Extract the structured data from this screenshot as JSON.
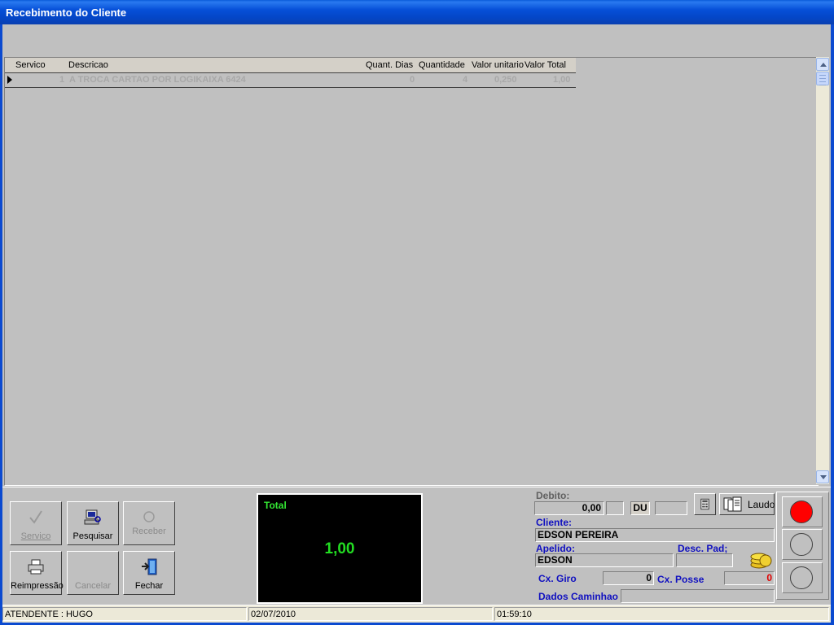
{
  "window": {
    "title": "Recebimento do Cliente"
  },
  "grid": {
    "columns": [
      "Servico",
      "Descricao",
      "Quant. Dias",
      "Quantidade",
      "Valor unitario",
      "Valor Total"
    ],
    "rows": [
      {
        "servico": "1",
        "descricao": "A TROCA CARTAO POR LOGIKAIXA 6424",
        "quant_dias": "0",
        "quantidade": "4",
        "valor_unitario": "0,250",
        "valor_total": "1,00"
      }
    ]
  },
  "toolbar": {
    "servico_label": "Servico",
    "pesquisar_label": "Pesquisar",
    "receber_label": "Receber",
    "reimpressao_label": "Reimpressão",
    "cancelar_label": "Cancelar",
    "fechar_label": "Fechar"
  },
  "total": {
    "label": "Total",
    "value": "1,00"
  },
  "right_panel": {
    "debito_label": "Debito:",
    "debito_value": "0,00",
    "du_label": "DU",
    "laudo_label": "Laudo",
    "cliente_label": "Cliente:",
    "cliente_value": "EDSON PEREIRA",
    "apelido_label": "Apelido:",
    "apelido_value": "EDSON",
    "desc_pad_label": "Desc. Pad;",
    "cx_giro_label": "Cx. Giro",
    "cx_giro_value": "0",
    "cx_posse_label": "Cx. Posse",
    "cx_posse_value": "0",
    "dados_caminhao_label": "Dados Caminhao"
  },
  "status_lights": {
    "colors": [
      "#ff0000",
      "#c0c0c0",
      "#c0c0c0"
    ]
  },
  "statusbar": {
    "atendente": "ATENDENTE : HUGO",
    "date": "02/07/2010",
    "time": "01:59:10"
  },
  "colors": {
    "titlebar": "#0650d8",
    "accent_blue": "#1010c0",
    "total_green": "#22dd22",
    "posse_red": "#e00000"
  }
}
